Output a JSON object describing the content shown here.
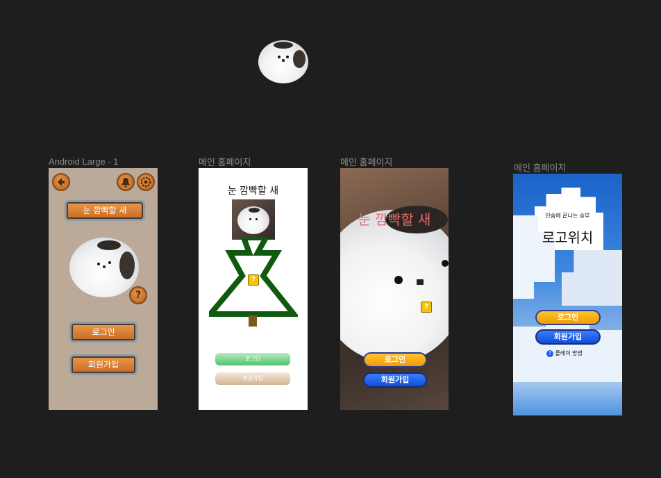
{
  "canvas": {
    "frames": [
      {
        "label": "Android Large - 1"
      },
      {
        "label": "메인 홈페이지"
      },
      {
        "label": "메인 홈페이지"
      },
      {
        "label": "메인 홈페이지"
      }
    ]
  },
  "frame1": {
    "title_button": "눈 깜빡할 새",
    "login_button": "로그인",
    "signup_button": "회원가입",
    "help_icon": "?"
  },
  "frame2": {
    "title": "눈 깜빡할 새",
    "login_button": "로그인",
    "signup_button": "회원가입",
    "question_block": "?"
  },
  "frame3": {
    "title": "눈 깜빡할 새",
    "login_button": "로그인",
    "signup_button": "회원가입",
    "question_block": "?"
  },
  "frame4": {
    "subtitle": "단숨에 끝나는 승부",
    "title": "로고위치",
    "login_button": "로그인",
    "signup_button": "회원가입",
    "howto_link": "플레이 방법"
  },
  "colors": {
    "canvas_bg": "#1e1e1e",
    "frame1_bg": "#bba99a",
    "tree_green": "#0f5a0f",
    "trunk_brown": "#7a5a18",
    "pill_yellow": "#f8a800",
    "pill_blue": "#1a5ce6"
  }
}
